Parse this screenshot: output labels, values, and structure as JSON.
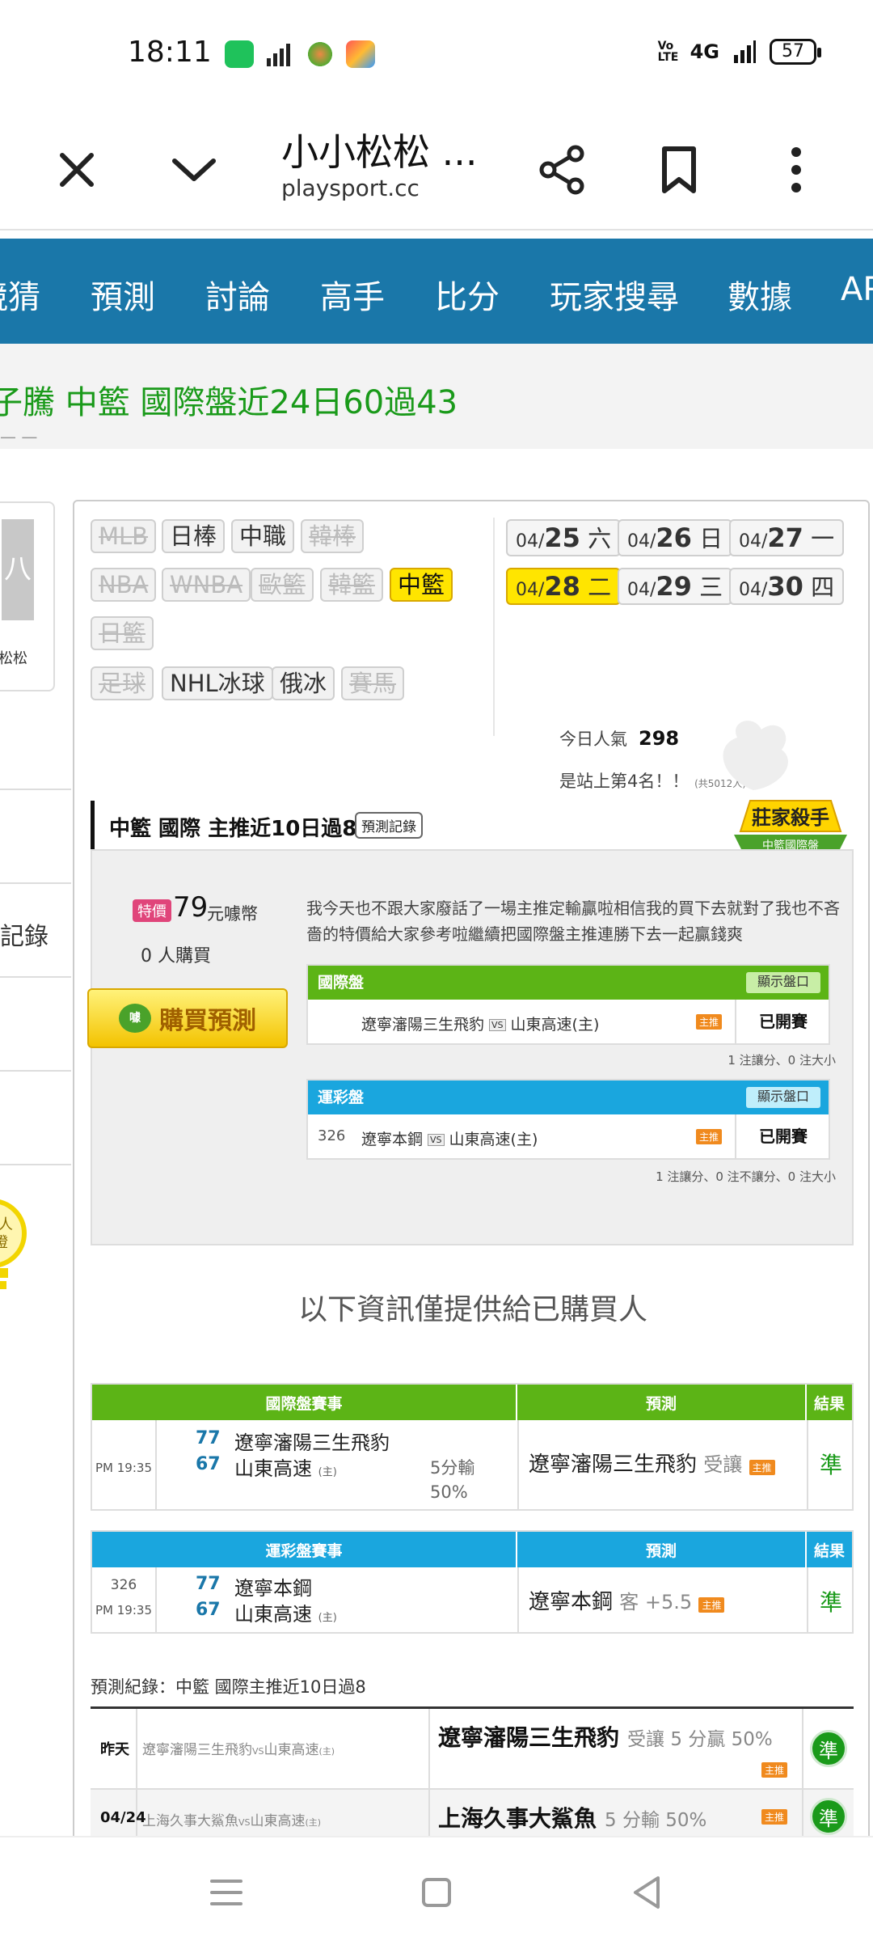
{
  "status_bar": {
    "time": "18:11",
    "network": "4G",
    "volte": "Vo LTE",
    "battery": "57"
  },
  "browser": {
    "title": "小小松松 ...",
    "url": "playsport.cc"
  },
  "site_nav": {
    "items": [
      "競猜",
      "預測",
      "討論",
      "高手",
      "比分",
      "玩家搜尋",
      "數據",
      "AP"
    ]
  },
  "banner": {
    "text": "子騰 中籃 國際盤近24日60過43"
  },
  "sidebar": {
    "avatar_initial": "八",
    "username": "松松",
    "menu": [
      "",
      "記錄",
      "",
      ""
    ],
    "bulb_text": "人\n燈"
  },
  "leagues": [
    {
      "label": "MLB",
      "state": "off"
    },
    {
      "label": "日棒",
      "state": "on"
    },
    {
      "label": "中職",
      "state": "on"
    },
    {
      "label": "韓棒",
      "state": "off"
    },
    {
      "label": "NBA",
      "state": "off"
    },
    {
      "label": "WNBA",
      "state": "off"
    },
    {
      "label": "歐籃",
      "state": "off"
    },
    {
      "label": "韓籃",
      "state": "off"
    },
    {
      "label": "中籃",
      "state": "active"
    },
    {
      "label": "日籃",
      "state": "off"
    },
    {
      "label": "足球",
      "state": "off"
    },
    {
      "label": "NHL冰球",
      "state": "on"
    },
    {
      "label": "俄冰",
      "state": "on"
    },
    {
      "label": "賽馬",
      "state": "off"
    }
  ],
  "dates": [
    {
      "md": "04/",
      "d": "25",
      "w": "六"
    },
    {
      "md": "04/",
      "d": "26",
      "w": "日"
    },
    {
      "md": "04/",
      "d": "27",
      "w": "一"
    },
    {
      "md": "04/",
      "d": "28",
      "w": "二"
    },
    {
      "md": "04/",
      "d": "29",
      "w": "三"
    },
    {
      "md": "04/",
      "d": "30",
      "w": "四"
    }
  ],
  "popularity": {
    "label": "今日人氣",
    "value": "298",
    "rank_text": "是站上第4名！！",
    "rank_total": "(共5012人)"
  },
  "section": {
    "title": "中籃 國際 主推近10日過8",
    "record_btn": "預測記錄",
    "badge_line1": "莊家殺手",
    "badge_line2": "中籃國際盤"
  },
  "purchase": {
    "special_tag": "特價",
    "price": "79",
    "unit": "元噱幣",
    "buyers": "0 人購買",
    "buy_button": "購買預測",
    "coin_icon_text": "噱",
    "description": "我今天也不跟大家廢話了一場主推定輸贏啦相信我的買下去就對了我也不吝嗇的特價給大家參考啦繼續把國際盤主推連勝下去一起贏錢爽"
  },
  "mini_tables": [
    {
      "header": "國際盤",
      "show_btn": "顯示盤口",
      "color": "#5cb416",
      "num": "",
      "home": "遼寧瀋陽三生飛豹",
      "vs": "VS",
      "away": "山東高速(主)",
      "tag": "主推",
      "status": "已開賽",
      "note": "1 注讓分、0 注大小"
    },
    {
      "header": "運彩盤",
      "show_btn": "顯示盤口",
      "color": "#1aa6de",
      "num": "326",
      "home": "遼寧本鋼",
      "vs": "VS",
      "away": "山東高速(主)",
      "tag": "主推",
      "status": "已開賽",
      "note": "1 注讓分、0 注不讓分、0 注大小"
    }
  ],
  "info_message": "以下資訊僅提供給已購買人",
  "results": [
    {
      "head_game": "國際盤賽事",
      "head_pred": "預測",
      "head_result": "結果",
      "color": "#5cb416",
      "num": "",
      "time": "PM 19:35",
      "score1": "77",
      "team1": "遼寧瀋陽三生飛豹",
      "score2": "67",
      "team2": "山東高速",
      "team2_tag": "(主)",
      "odds1": "5分輸",
      "odds2": "50%",
      "pick": "遼寧瀋陽三生飛豹",
      "pick_extra": "受讓",
      "pick_tag": "主推",
      "result": "準"
    },
    {
      "head_game": "運彩盤賽事",
      "head_pred": "預測",
      "head_result": "結果",
      "color": "#1aa6de",
      "num": "326",
      "time": "PM 19:35",
      "score1": "77",
      "team1": "遼寧本鋼",
      "score2": "67",
      "team2": "山東高速",
      "team2_tag": "(主)",
      "odds1": "",
      "odds2": "",
      "pick": "遼寧本鋼",
      "pick_extra": "客 +5.5",
      "pick_tag": "主推",
      "result": "準"
    }
  ],
  "record": {
    "title": "預測紀錄：中籃 國際主推近10日過8",
    "rows": [
      {
        "day": "昨天",
        "match": "遼寧瀋陽三生飛豹",
        "vs": "VS",
        "opp": "山東高速",
        "opp_tag": "(主)",
        "pick": "遼寧瀋陽三生飛豹",
        "detail": "受讓 5 分贏 50%",
        "tag": "主推",
        "result": "準"
      },
      {
        "day": "04/24",
        "match": "上海久事大鯊魚",
        "vs": "VS",
        "opp": "山東高速",
        "opp_tag": "(主)",
        "pick": "上海久事大鯊魚",
        "detail": "5 分輸 50%",
        "tag": "主推",
        "result": "準"
      }
    ]
  },
  "colors": {
    "nav_blue": "#1a77a9",
    "green": "#5cb416",
    "cyan": "#1aa6de",
    "yellow": "#ffe500"
  }
}
